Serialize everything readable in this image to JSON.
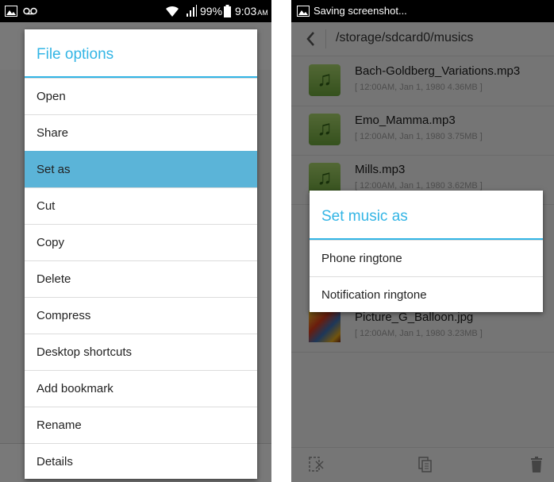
{
  "left": {
    "status": {
      "battery": "99%",
      "time": "9:03",
      "ampm": "AM"
    },
    "dialog": {
      "title": "File options",
      "items": [
        "Open",
        "Share",
        "Set as",
        "Cut",
        "Copy",
        "Delete",
        "Compress",
        "Desktop shortcuts",
        "Add bookmark",
        "Rename",
        "Details"
      ],
      "selected_index": 2
    }
  },
  "right": {
    "status": {
      "notification": "Saving screenshot..."
    },
    "path": "/storage/sdcard0/musics",
    "files": [
      {
        "name": "Bach-Goldberg_Variations.mp3",
        "meta": "[ 12:00AM, Jan 1, 1980 4.36MB ]",
        "icon": "music-note-icon"
      },
      {
        "name": "Emo_Mamma.mp3",
        "meta": "[ 12:00AM, Jan 1, 1980 3.75MB ]",
        "icon": "music-note-icon"
      },
      {
        "name": "Mills.mp3",
        "meta": "[ 12:00AM, Jan 1, 1980 3.62MB ]",
        "icon": "music-note-icon"
      },
      {
        "name": "Picture_G_Balloon.jpg",
        "meta": "[ 12:00AM, Jan 1, 1980 3.23MB ]",
        "icon": "image-thumbnail"
      }
    ],
    "dialog": {
      "title": "Set music as",
      "items": [
        "Phone ringtone",
        "Notification ringtone"
      ]
    }
  }
}
